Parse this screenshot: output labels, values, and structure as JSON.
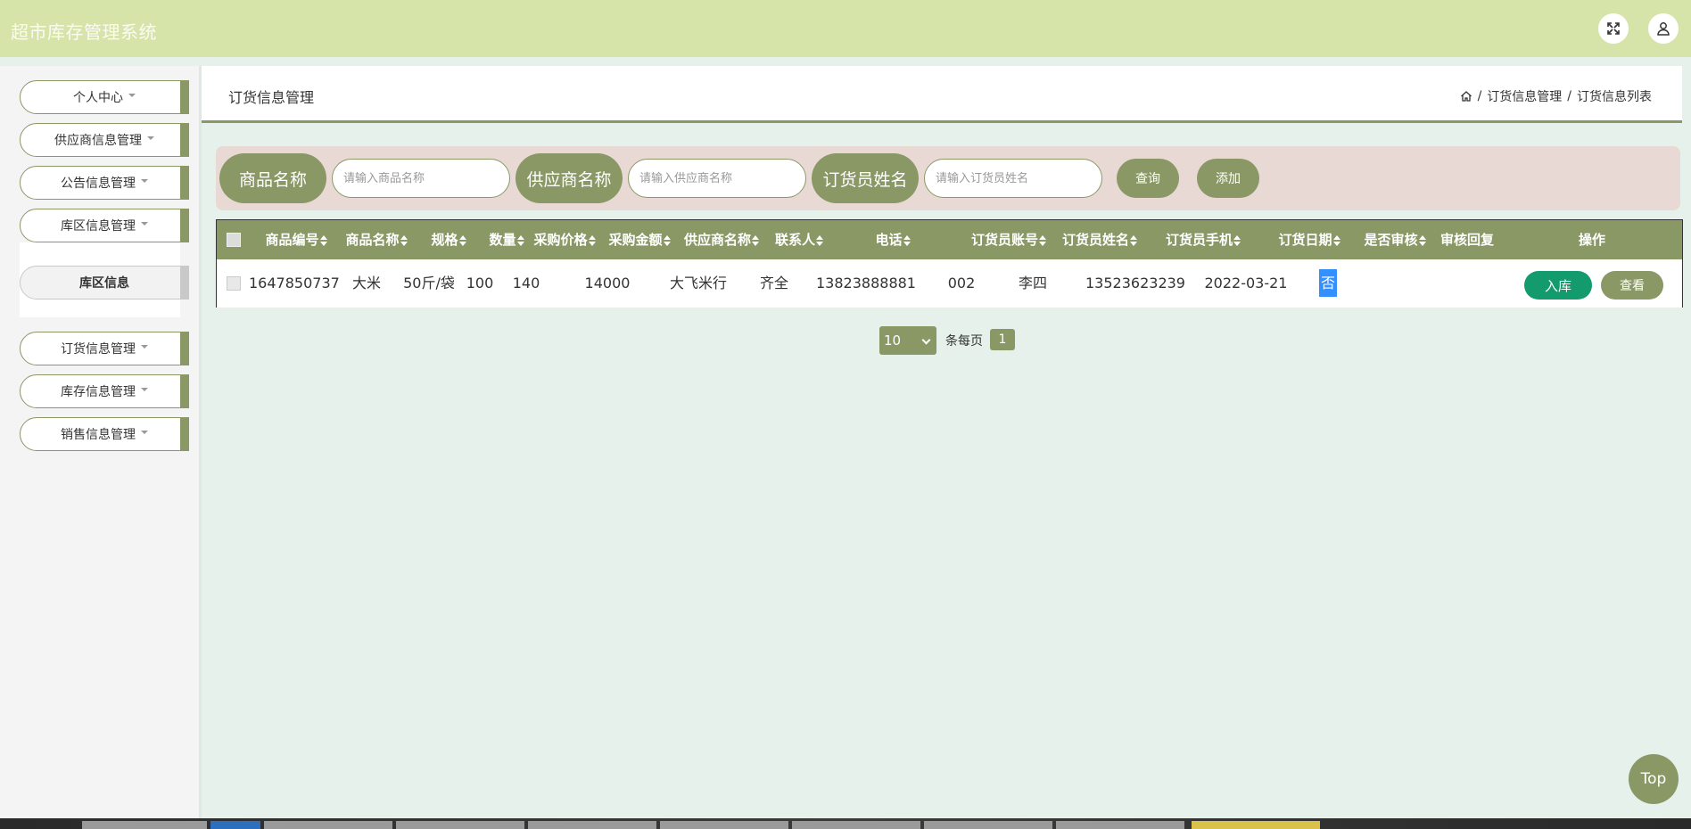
{
  "app": {
    "title": "超市库存管理系统"
  },
  "header_icons": {
    "fullscreen": "fullscreen-icon",
    "user": "user-icon"
  },
  "sidebar": {
    "items": [
      {
        "label": "个人中心"
      },
      {
        "label": "供应商信息管理"
      },
      {
        "label": "公告信息管理"
      },
      {
        "label": "库区信息管理"
      },
      {
        "label": "库区信息"
      },
      {
        "label": "订货信息管理"
      },
      {
        "label": "库存信息管理"
      },
      {
        "label": "销售信息管理"
      }
    ]
  },
  "page": {
    "title": "订货信息管理",
    "breadcrumb": {
      "home_icon": "home-icon",
      "level1": "订货信息管理",
      "level2": "订货信息列表",
      "sep": "/"
    }
  },
  "search": {
    "product_label": "商品名称",
    "product_placeholder": "请输入商品名称",
    "supplier_label": "供应商名称",
    "supplier_placeholder": "请输入供应商名称",
    "orderer_label": "订货员姓名",
    "orderer_placeholder": "请输入订货员姓名",
    "query_button": "查询",
    "add_button": "添加"
  },
  "table": {
    "headers": [
      "商品编号",
      "商品名称",
      "规格",
      "数量",
      "采购价格",
      "采购金额",
      "供应商名称",
      "联系人",
      "电话",
      "订货员账号",
      "订货员姓名",
      "订货员手机",
      "订货日期",
      "是否审核",
      "审核回复",
      "操作"
    ],
    "rows": [
      {
        "product_id": "1647850737",
        "product_name": "大米",
        "spec": "50斤/袋",
        "quantity": "100",
        "price": "140",
        "amount": "14000",
        "supplier": "大飞米行",
        "contact": "齐全",
        "phone": "13823888881",
        "orderer_account": "002",
        "orderer_name": "李四",
        "orderer_phone": "13523623239",
        "order_date": "2022-03-21",
        "audited": "否",
        "audit_reply": "",
        "stock_in_button": "入库",
        "view_button": "查看"
      }
    ]
  },
  "pagination": {
    "page_size": "10",
    "per_page_label": "条每页",
    "current_page": "1"
  },
  "top_button": "Top",
  "colors": {
    "accent": "#8a9866",
    "header_bg": "#d6e4aa",
    "content_bg": "#e5f1ea",
    "search_bg": "#e8d9d4",
    "stock_btn": "#139a6d",
    "selection": "#3390ff"
  }
}
